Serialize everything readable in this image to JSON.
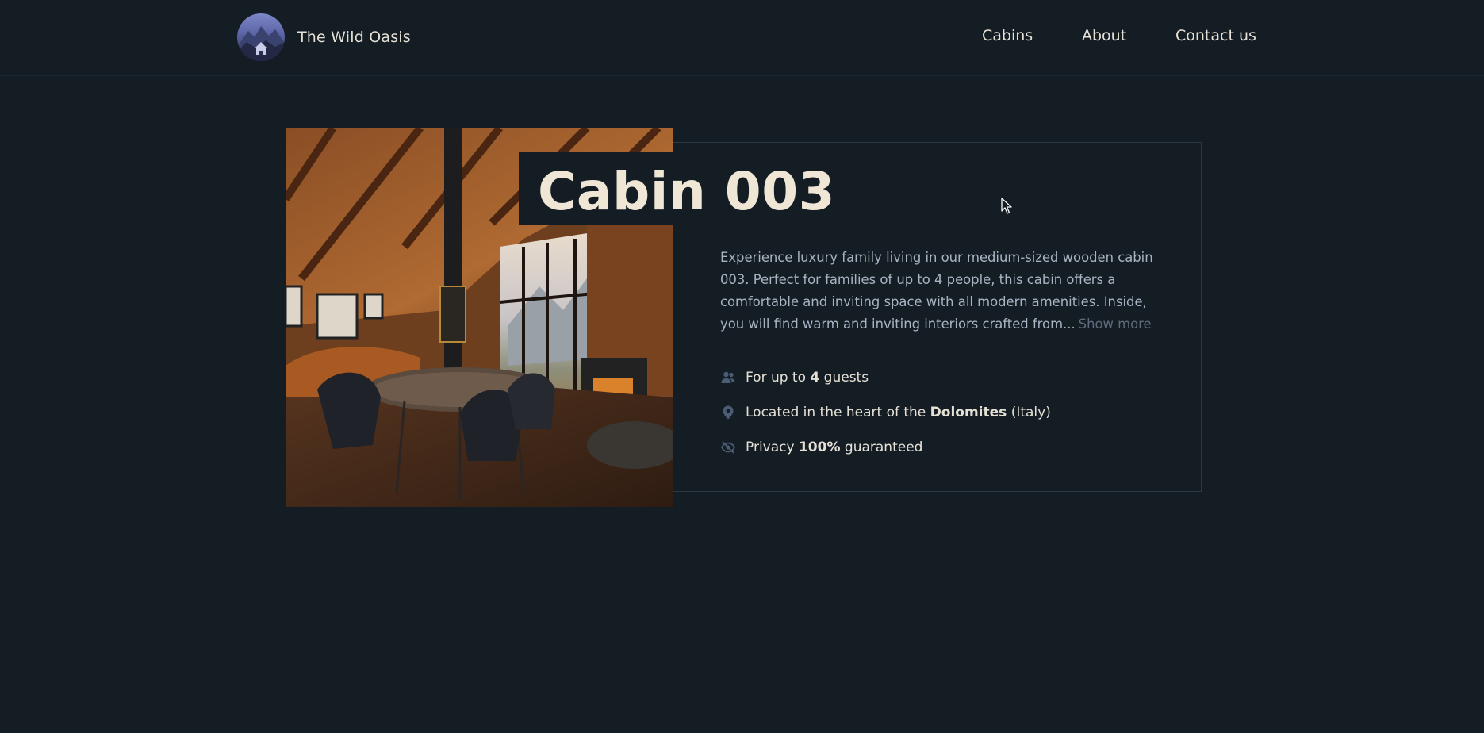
{
  "header": {
    "brand": "The Wild Oasis",
    "nav": {
      "cabins": "Cabins",
      "about": "About",
      "contact": "Contact us"
    }
  },
  "cabin": {
    "title": "Cabin 003",
    "description": "Experience luxury family living in our medium-sized wooden cabin 003. Perfect for families of up to 4 people, this cabin offers a comfortable and inviting space with all modern amenities. Inside, you will find warm and inviting interiors crafted from...",
    "show_more": "Show more",
    "features": {
      "guests_prefix": "For up to",
      "guests_count": "4",
      "guests_suffix": "guests",
      "location_prefix": "Located in the heart of the",
      "location_name": "Dolomites",
      "location_suffix": "(Italy)",
      "privacy_prefix": "Privacy",
      "privacy_value": "100%",
      "privacy_suffix": "guaranteed"
    }
  },
  "icons": {
    "guests": "users-icon",
    "location": "map-pin-icon",
    "privacy": "eye-slash-icon"
  },
  "colors": {
    "background": "#141c24",
    "text": "#e6e1d6",
    "muted": "#a9b3c2",
    "icon": "#4b5d76",
    "border": "#2c3844"
  }
}
